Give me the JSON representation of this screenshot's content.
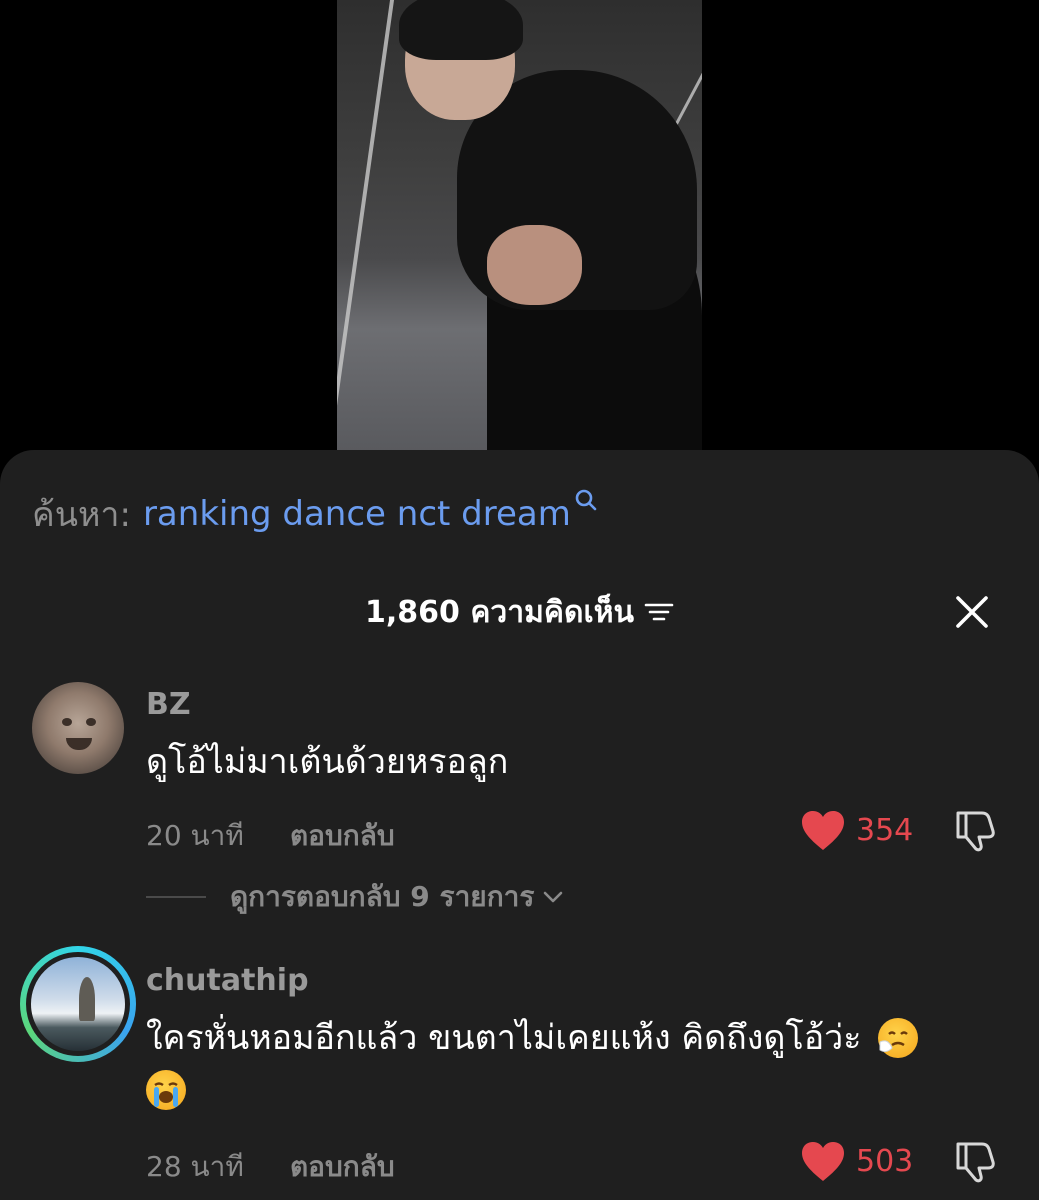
{
  "search": {
    "prefix": "ค้นหา:",
    "query": "ranking dance nct dream"
  },
  "comments_header": {
    "count_label": "1,860 ความคิดเห็น"
  },
  "comments": [
    {
      "username": "BZ",
      "text": "ดูโอ้ไม่มาเต้นด้วยหรอลูก",
      "time": "20 นาที",
      "reply_label": "ตอบกลับ",
      "likes": "354",
      "view_replies": "ดูการตอบกลับ 9 รายการ"
    },
    {
      "username": "chutathip",
      "text_line1": "ใครหั่นหอมอีกแล้ว ขนตาไม่เคยแห้ง คิดถึงดูโอ้ว่ะ",
      "emoji_1": "🤧",
      "emoji_2": "😭",
      "time": "28 นาที",
      "reply_label": "ตอบกลับ",
      "likes": "503"
    }
  ],
  "colors": {
    "sheet_bg": "#1f1f1f",
    "link_blue": "#6b9cef",
    "like_red": "#e5484f",
    "muted_text": "#8a8a8a"
  },
  "icons": [
    "search-icon",
    "filter-icon",
    "close-icon",
    "heart-icon",
    "dislike-icon",
    "chevron-down-icon"
  ]
}
